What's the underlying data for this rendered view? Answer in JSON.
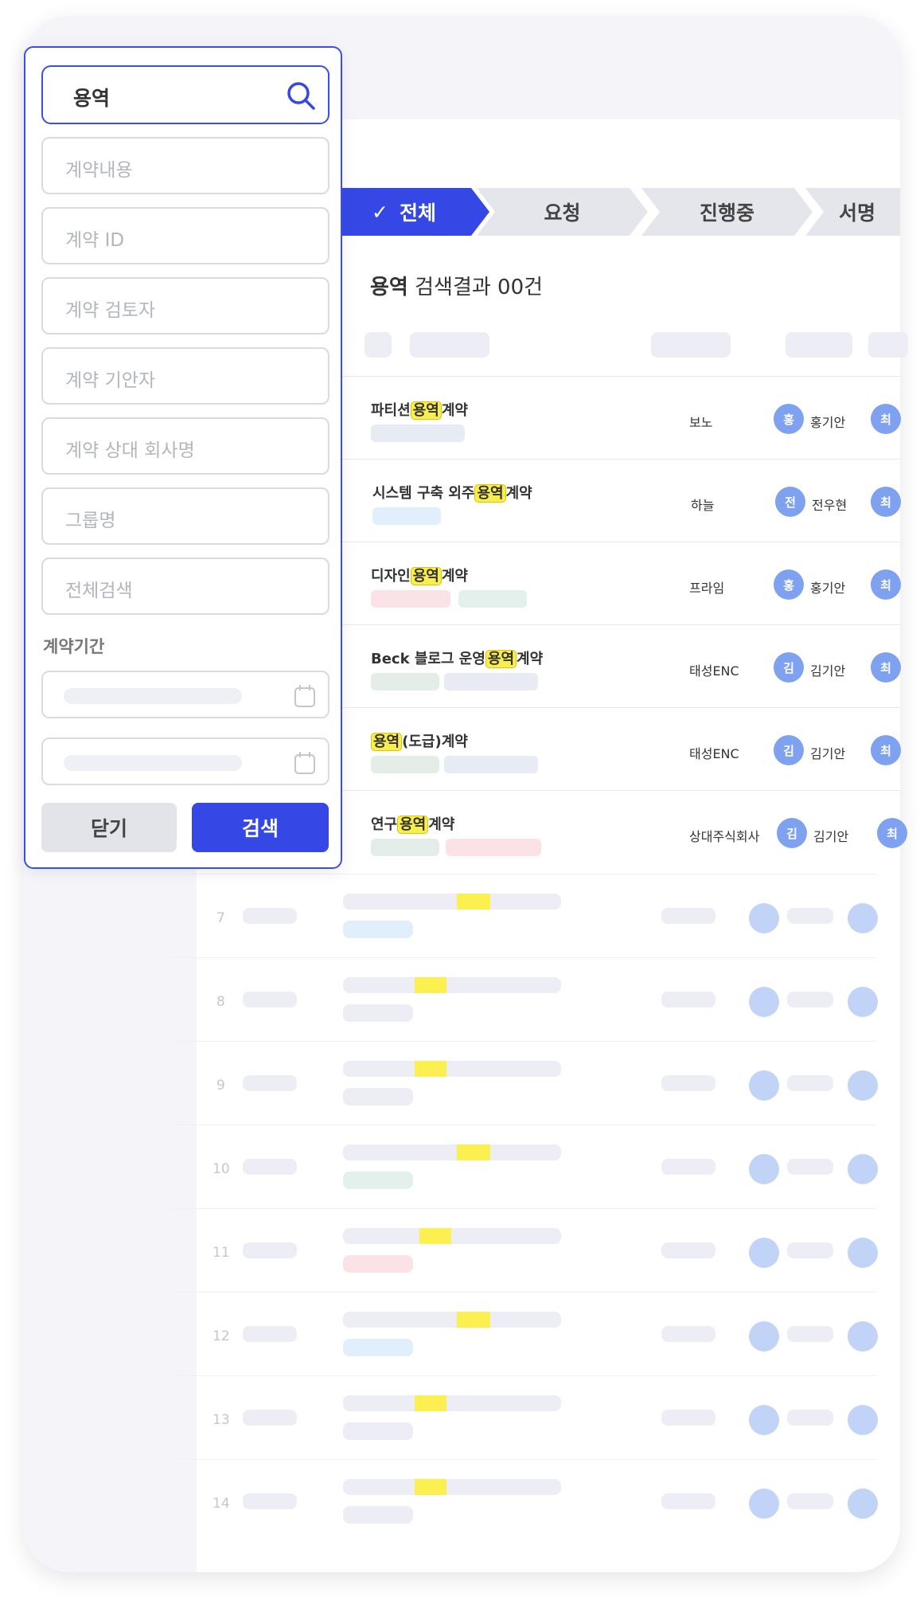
{
  "steps": {
    "all": "전체",
    "request": "요청",
    "in_progress": "진행중",
    "sign": "서명",
    "check": "✓"
  },
  "results": {
    "keyword": "용역",
    "suffix": "검색결과 00건"
  },
  "rows": [
    {
      "pre": "파티션",
      "hl": "용역",
      "post": "계약",
      "company": "보노",
      "avatar": "홍",
      "person": "홍기안",
      "avatar2": "최"
    },
    {
      "pre": "시스템 구축 외주",
      "hl": "용역",
      "post": "계약",
      "company": "하늘",
      "avatar": "전",
      "person": "전우현",
      "avatar2": "최"
    },
    {
      "pre": "디자인",
      "hl": "용역",
      "post": "계약",
      "company": "프라임",
      "avatar": "홍",
      "person": "홍기안",
      "avatar2": "최"
    },
    {
      "pre": "Beck 블로그 운영",
      "hl": "용역",
      "post": "계약",
      "company": "태성ENC",
      "avatar": "김",
      "person": "김기안",
      "avatar2": "최"
    },
    {
      "pre": "",
      "hl": "용역",
      "post": "(도급)계약",
      "company": "태성ENC",
      "avatar": "김",
      "person": "김기안",
      "avatar2": "최"
    },
    {
      "pre": "연구",
      "hl": "용역",
      "post": "계약",
      "company": "상대주식회사",
      "avatar": "김",
      "person": "김기안",
      "avatar2": "최"
    }
  ],
  "skeleton_rows": [
    "7",
    "8",
    "9",
    "10",
    "11",
    "12",
    "13",
    "14"
  ],
  "filter": {
    "search_value": "용역",
    "fields": [
      "계약내용",
      "계약 ID",
      "계약 검토자",
      "계약 기안자",
      "계약 상대 회사명",
      "그룹명",
      "전체검색"
    ],
    "period_label": "계약기간",
    "close_label": "닫기",
    "search_label": "검색"
  },
  "colors": {
    "accent": "#3548e5",
    "highlight": "#f8ef4f",
    "avatar": "#7ea2ef"
  },
  "icons": [
    "search-icon",
    "calendar-icon",
    "check-icon"
  ]
}
